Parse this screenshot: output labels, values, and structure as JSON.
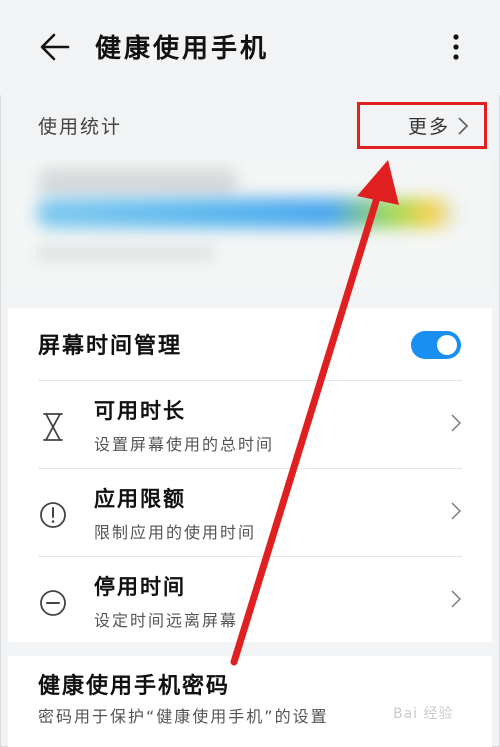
{
  "header": {
    "title": "健康使用手机",
    "back_icon": "arrow-left-icon",
    "menu_icon": "more-vertical-icon"
  },
  "stats": {
    "label": "使用统计",
    "more_label": "更多"
  },
  "screen_time": {
    "title": "屏幕时间管理",
    "toggle_on": true,
    "accent": "#1a8ff2",
    "items": [
      {
        "icon": "hourglass-icon",
        "title": "可用时长",
        "subtitle": "设置屏幕使用的总时间"
      },
      {
        "icon": "alert-circle-icon",
        "title": "应用限额",
        "subtitle": "限制应用的使用时间"
      },
      {
        "icon": "minus-circle-icon",
        "title": "停用时间",
        "subtitle": "设定时间远离屏幕"
      }
    ]
  },
  "password": {
    "title": "健康使用手机密码",
    "description": "密码用于保护“健康使用手机”的设置"
  },
  "annotation": {
    "color": "#e02020"
  },
  "watermark": "Bai 经验"
}
